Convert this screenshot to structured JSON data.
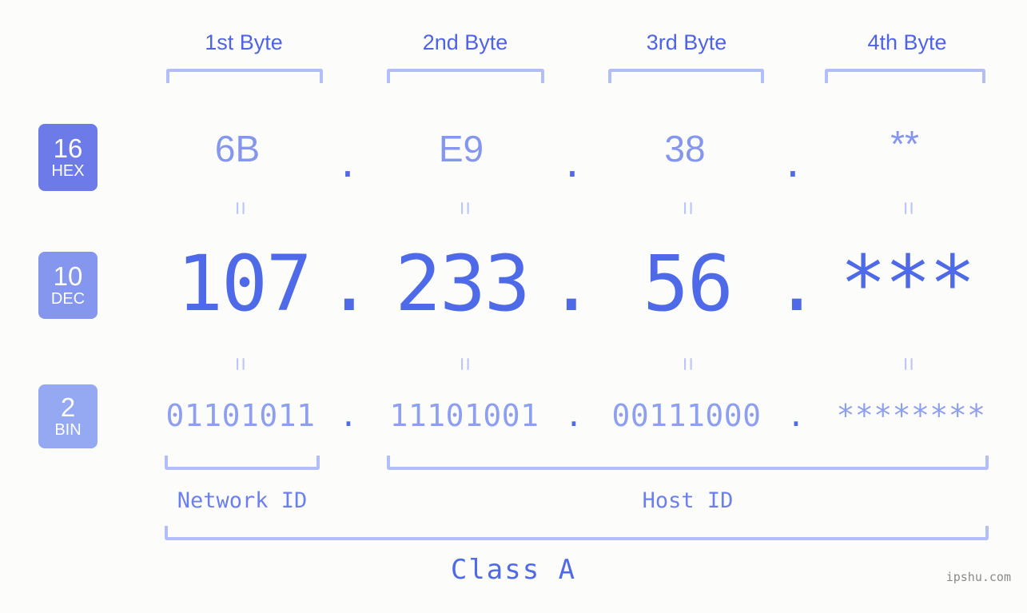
{
  "background_color": "#fcfdfa",
  "accent_colors": {
    "header_text": "#4f63e8",
    "bracket": "#b3bdf7",
    "hex_value": "#8496ee",
    "dec_value": "#4f6ae8",
    "bin_value": "#8e9ff0",
    "badge_hex": "#6c7be8",
    "badge_dec": "#8496ee",
    "badge_bin": "#94a9f2",
    "equals_marker": "#bcc6f8",
    "id_label": "#6c7fef",
    "watermark": "#8a8a8a"
  },
  "byte_headers": [
    {
      "label": "1st Byte"
    },
    {
      "label": "2nd Byte"
    },
    {
      "label": "3rd Byte"
    },
    {
      "label": "4th Byte"
    }
  ],
  "radix_badges": [
    {
      "number": "16",
      "name": "HEX"
    },
    {
      "number": "10",
      "name": "DEC"
    },
    {
      "number": "2",
      "name": "BIN"
    }
  ],
  "rows": {
    "hex": {
      "values": [
        "6B",
        "E9",
        "38",
        "**"
      ],
      "separators": [
        ".",
        ".",
        "."
      ]
    },
    "dec": {
      "values": [
        "107",
        "233",
        "56",
        "***"
      ],
      "separators": [
        ".",
        ".",
        "."
      ]
    },
    "bin": {
      "values": [
        "01101011",
        "11101001",
        "00111000",
        "********"
      ],
      "separators": [
        ".",
        ".",
        "."
      ]
    }
  },
  "equals_marker": "=",
  "id_sections": [
    {
      "label": "Network ID"
    },
    {
      "label": "Host ID"
    }
  ],
  "class_label": "Class A",
  "watermark": "ipshu.com"
}
